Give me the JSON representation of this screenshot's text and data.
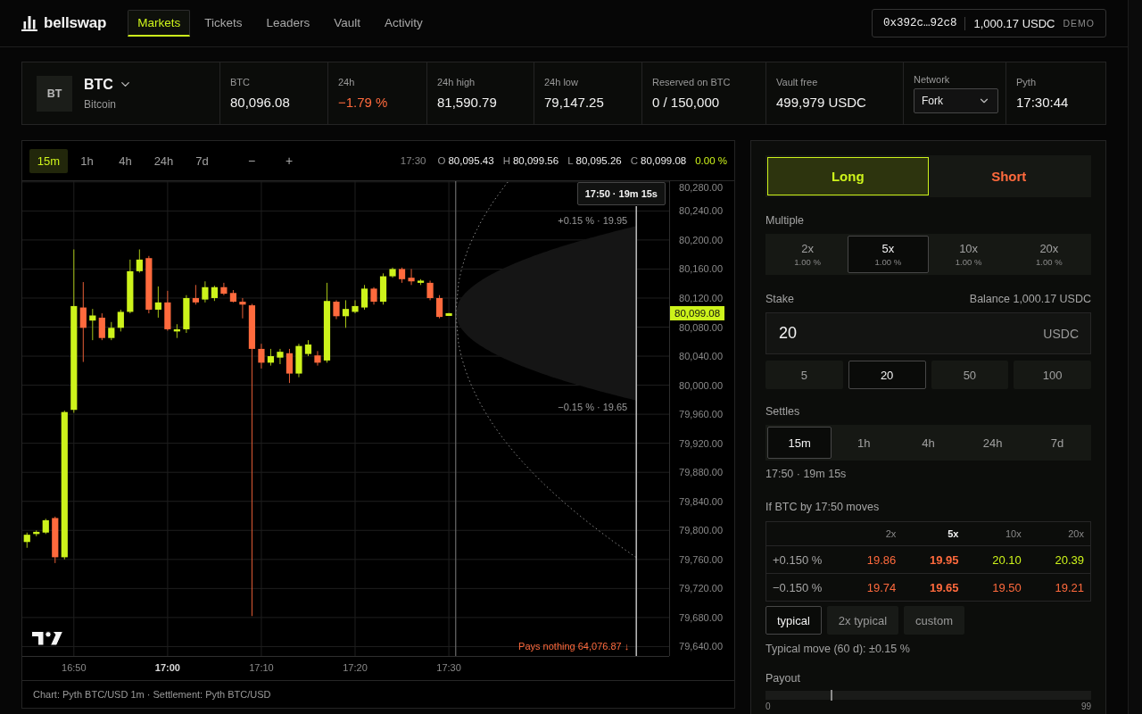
{
  "header": {
    "brand": "bellswap",
    "nav": [
      {
        "label": "Markets",
        "selected": true
      },
      {
        "label": "Tickets",
        "selected": false
      },
      {
        "label": "Leaders",
        "selected": false
      },
      {
        "label": "Vault",
        "selected": false
      },
      {
        "label": "Activity",
        "selected": false
      }
    ],
    "wallet": {
      "address": "0x392c…92c8",
      "balance": "1,000.17 USDC",
      "mode": "DEMO"
    }
  },
  "market": {
    "asset": {
      "badge": "BT",
      "symbol": "BTC",
      "name": "Bitcoin"
    },
    "stats": [
      {
        "label": "BTC",
        "value": "80,096.08"
      },
      {
        "label": "24h",
        "value": "−1.79 %",
        "color": "#ff6a3d"
      },
      {
        "label": "24h high",
        "value": "81,590.79"
      },
      {
        "label": "24h low",
        "value": "79,147.25"
      },
      {
        "label": "Reserved on BTC",
        "value": "0 / 150,000"
      },
      {
        "label": "Vault free",
        "value": "499,979 USDC"
      }
    ],
    "network": {
      "label": "Network",
      "value": "Fork"
    },
    "oracle": {
      "label": "Pyth",
      "value": "17:30:44"
    }
  },
  "chart_panel": {
    "intervals": [
      {
        "label": "15m",
        "selected": true
      },
      {
        "label": "1h",
        "selected": false
      },
      {
        "label": "4h",
        "selected": false
      },
      {
        "label": "24h",
        "selected": false
      },
      {
        "label": "7d",
        "selected": false
      }
    ],
    "zoom_buttons": [
      "−",
      "+"
    ],
    "ohlc": {
      "time": "17:30",
      "fields": [
        {
          "key": "O",
          "value": "80,095.43"
        },
        {
          "key": "H",
          "value": "80,099.56"
        },
        {
          "key": "L",
          "value": "80,095.26"
        },
        {
          "key": "C",
          "value": "80,099.08"
        }
      ],
      "change": "0.00 %"
    },
    "chart": {
      "price_axis": [
        "80,280.00",
        "80,240.00",
        "80,200.00",
        "80,160.00",
        "80,120.00",
        "80,080.00",
        "80,040.00",
        "80,000.00",
        "79,960.00",
        "79,920.00",
        "79,880.00",
        "79,840.00",
        "79,800.00",
        "79,760.00",
        "79,720.00",
        "79,680.00",
        "79,640.00"
      ],
      "time_axis": [
        {
          "label": "16:50",
          "major": false
        },
        {
          "label": "17:00",
          "major": true
        },
        {
          "label": "17:10",
          "major": false
        },
        {
          "label": "17:20",
          "major": false
        },
        {
          "label": "17:30",
          "major": false
        }
      ],
      "settlement_tag": "17:50 · 19m 15s",
      "last_price": "80,099.08",
      "band_labels": [
        "+0.15 % · 19.95",
        "−0.15 % · 19.65"
      ],
      "floor_label": "Pays nothing 64,076.87 ↓"
    },
    "footer": "Chart: Pyth BTC/USD 1m · Settlement: Pyth BTC/USD"
  },
  "order": {
    "side": [
      {
        "label": "Long",
        "kind": "long",
        "selected": true
      },
      {
        "label": "Short",
        "kind": "short",
        "selected": false
      }
    ],
    "multiple": {
      "label": "Multiple",
      "options": [
        {
          "label": "2x",
          "fee": "1.00 %",
          "selected": false
        },
        {
          "label": "5x",
          "fee": "1.00 %",
          "selected": true
        },
        {
          "label": "10x",
          "fee": "1.00 %",
          "selected": false
        },
        {
          "label": "20x",
          "fee": "1.00 %",
          "selected": false
        }
      ]
    },
    "stake": {
      "label": "Stake",
      "balance": "Balance 1,000.17 USDC",
      "value": "20",
      "unit": "USDC",
      "presets": [
        {
          "label": "5",
          "selected": false
        },
        {
          "label": "20",
          "selected": true
        },
        {
          "label": "50",
          "selected": false
        },
        {
          "label": "100",
          "selected": false
        }
      ]
    },
    "settles": {
      "label": "Settles",
      "options": [
        {
          "label": "15m",
          "selected": true
        },
        {
          "label": "1h",
          "selected": false
        },
        {
          "label": "4h",
          "selected": false
        },
        {
          "label": "24h",
          "selected": false
        },
        {
          "label": "7d",
          "selected": false
        }
      ],
      "note": "17:50 · 19m 15s"
    },
    "scenarios": {
      "title": "If BTC by 17:50 moves",
      "columns": [
        {
          "label": "2x",
          "selected": false
        },
        {
          "label": "5x",
          "selected": true
        },
        {
          "label": "10x",
          "selected": false
        },
        {
          "label": "20x",
          "selected": false
        }
      ],
      "rows": [
        {
          "label": "+0.150 %",
          "cells": [
            {
              "text": "19.86",
              "color": "#ff6a3d"
            },
            {
              "text": "19.95",
              "color": "#ff6a3d"
            },
            {
              "text": "20.10",
              "color": "#cdf31b"
            },
            {
              "text": "20.39",
              "color": "#cdf31b"
            }
          ]
        },
        {
          "label": "−0.150 %",
          "cells": [
            {
              "text": "19.74",
              "color": "#ff6a3d"
            },
            {
              "text": "19.65",
              "color": "#ff6a3d"
            },
            {
              "text": "19.50",
              "color": "#ff6a3d"
            },
            {
              "text": "19.21",
              "color": "#ff6a3d"
            }
          ]
        }
      ],
      "modes": [
        {
          "label": "typical",
          "selected": true
        },
        {
          "label": "2x typical",
          "selected": false
        },
        {
          "label": "custom",
          "selected": false
        }
      ],
      "note": "Typical move (60 d): ±0.15 %"
    },
    "payout": {
      "label": "Payout",
      "level": 0.2,
      "min": "0",
      "max": "99"
    }
  }
}
